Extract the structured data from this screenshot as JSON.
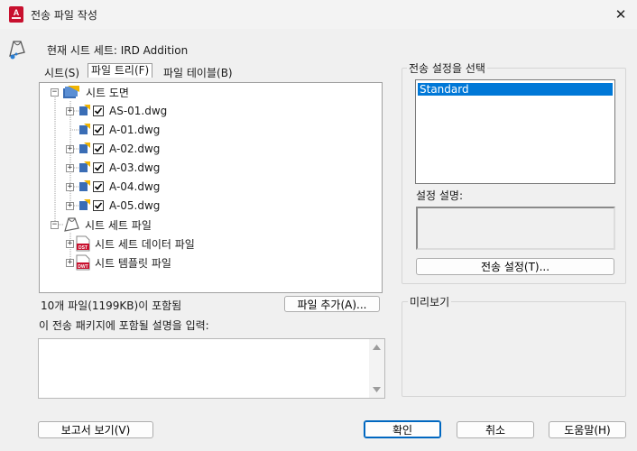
{
  "window": {
    "title": "전송 파일 작성",
    "close_label": "✕",
    "app_icon_letter": "A"
  },
  "sheetset": {
    "current_label": "현재 시트 세트: IRD Addition"
  },
  "tabs": [
    {
      "label": "시트(S)",
      "active": false
    },
    {
      "label": "파일 트리(F)",
      "active": true
    },
    {
      "label": "파일 테이블(B)",
      "active": false
    }
  ],
  "tree": {
    "root": "시트 도면",
    "files": [
      "AS-01.dwg",
      "A-01.dwg",
      "A-02.dwg",
      "A-03.dwg",
      "A-04.dwg",
      "A-05.dwg"
    ],
    "sheetset_files_root": "시트 세트 파일",
    "sheetset_children": [
      {
        "label": "시트 세트 데이터 파일",
        "badge": "DST"
      },
      {
        "label": "시트 템플릿 파일",
        "badge": "DWT"
      }
    ]
  },
  "file_count": "10개 파일(1199KB)이 포함됨",
  "add_file_button": "파일 추가(A)...",
  "description_label": "이 전송 패키지에 포함될 설명을 입력:",
  "description_value": "",
  "transmit_setup": {
    "group_title": "전송 설정을 선택",
    "items": [
      "Standard"
    ],
    "selected": "Standard",
    "description_label": "설정 설명:",
    "setup_button": "전송 설정(T)..."
  },
  "preview": {
    "group_title": "미리보기"
  },
  "footer": {
    "report_button": "보고서 보기(V)",
    "ok_button": "확인",
    "cancel_button": "취소",
    "help_button": "도움말(H)"
  },
  "colors": {
    "selection": "#0078d7",
    "autocad_red": "#c8102e",
    "primary_border": "#0067c0"
  }
}
